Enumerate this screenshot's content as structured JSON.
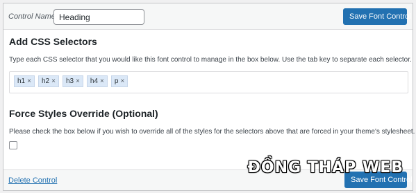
{
  "header": {
    "control_name_label": "Control Name",
    "control_name_value": "Heading",
    "save_label": "Save Font Control"
  },
  "css_section": {
    "title": "Add CSS Selectors",
    "description": "Type each CSS selector that you would like this font control to manage in the box below. Use the tab key to separate each selector.",
    "selectors": [
      "h1",
      "h2",
      "h3",
      "h4",
      "p"
    ],
    "remove_glyph": "×"
  },
  "force_section": {
    "title": "Force Styles Override (Optional)",
    "description": "Please check the box below if you wish to override all of the styles for the selectors above that are forced in your theme's stylesheet.",
    "checked": false
  },
  "footer": {
    "delete_label": "Delete Control",
    "save_label": "Save Font Control"
  },
  "watermark": "ĐỒNG THÁP WEB",
  "colors": {
    "primary": "#2271b1",
    "tag_bg": "#dbe8f7"
  }
}
